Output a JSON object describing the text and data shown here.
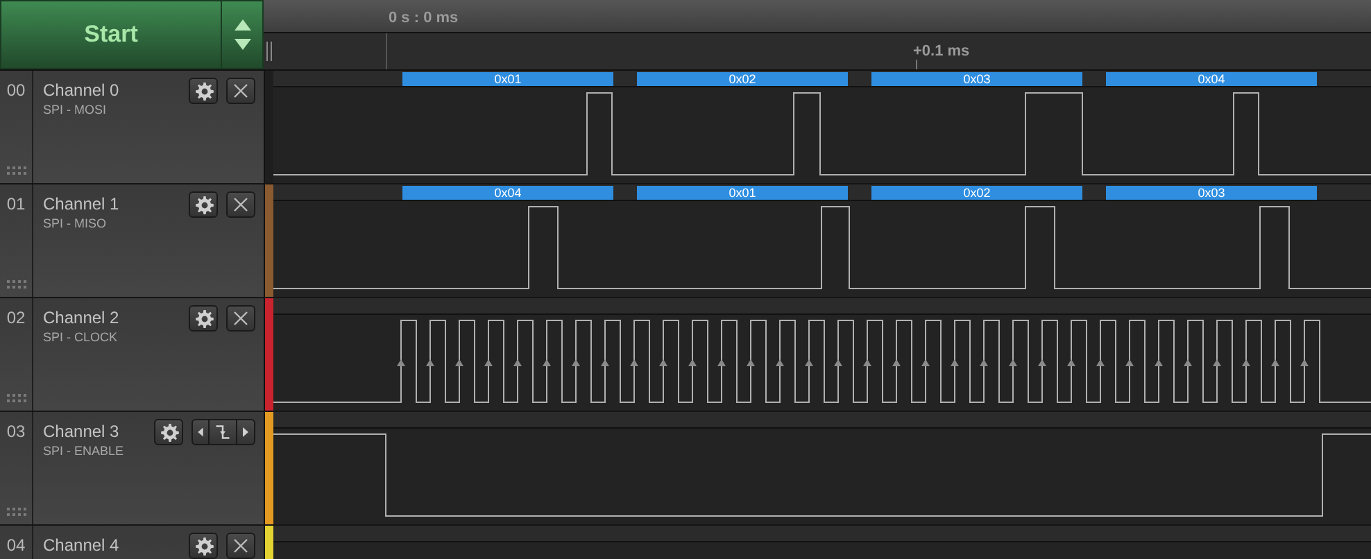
{
  "start_button": {
    "label": "Start"
  },
  "timeline": {
    "start_label": "0 s : 0 ms",
    "offset_label": "+0.1 ms"
  },
  "channels": [
    {
      "number": "00",
      "name": "Channel 0",
      "label": "SPI - MOSI",
      "color": "#1e1e1e",
      "kind": "standard",
      "decoded": [
        "0x01",
        "0x02",
        "0x03",
        "0x04"
      ]
    },
    {
      "number": "01",
      "name": "Channel 1",
      "label": "SPI - MISO",
      "color": "#8a5a30",
      "kind": "standard",
      "decoded": [
        "0x04",
        "0x01",
        "0x02",
        "0x03"
      ]
    },
    {
      "number": "02",
      "name": "Channel 2",
      "label": "SPI - CLOCK",
      "color": "#c8232e",
      "kind": "standard"
    },
    {
      "number": "03",
      "name": "Channel 3",
      "label": "SPI - ENABLE",
      "color": "#e39a22",
      "kind": "trigger"
    },
    {
      "number": "04",
      "name": "Channel 4",
      "color": "#e2d232",
      "kind": "standard"
    }
  ]
}
